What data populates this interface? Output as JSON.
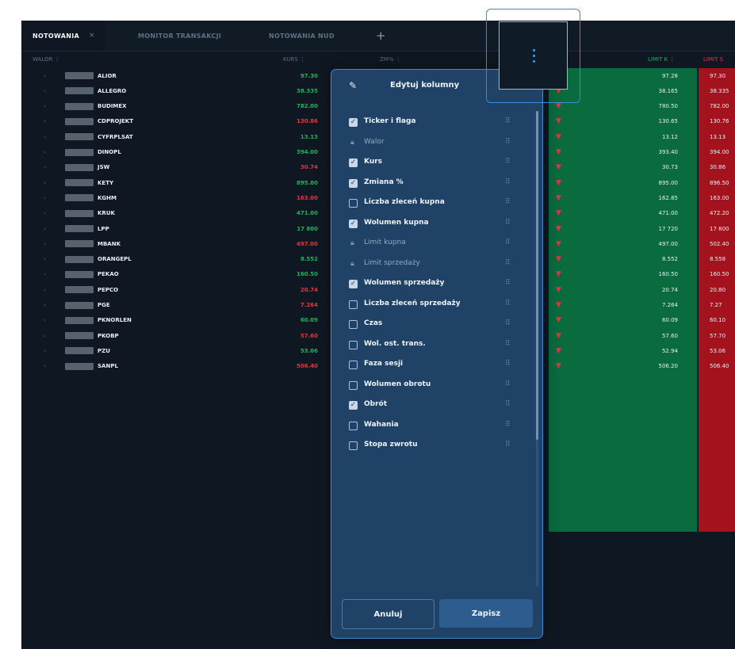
{
  "tabs": [
    {
      "label": "NOTOWANIA",
      "active": true,
      "close": "×"
    },
    {
      "label": "MONITOR TRANSAKCJI",
      "active": false
    },
    {
      "label": "NOTOWANIA NUD",
      "active": false
    }
  ],
  "add_tab": "+",
  "header": {
    "walor": "WALOR ⋮",
    "kurs": "KURS ⋮",
    "zmiana": "ZM% ⋮",
    "limit_k": "LIMIT K ⋮",
    "limit_s": "LIMIT S"
  },
  "rows": [
    {
      "ticker": "ALIOR",
      "price": "97.30",
      "color": "green",
      "limit_k": "97.28",
      "limit_s": "97.30"
    },
    {
      "ticker": "ALLEGRO",
      "price": "38.335",
      "color": "green",
      "limit_k": "38.165",
      "limit_s": "38.335"
    },
    {
      "ticker": "BUDIMEX",
      "price": "782.00",
      "color": "green",
      "limit_k": "780.50",
      "limit_s": "782.00"
    },
    {
      "ticker": "CDPROJEKT",
      "price": "130.86",
      "color": "red",
      "limit_k": "130.65",
      "limit_s": "130.76"
    },
    {
      "ticker": "CYFRPLSAT",
      "price": "13.13",
      "color": "green",
      "limit_k": "13.12",
      "limit_s": "13.13"
    },
    {
      "ticker": "DINOPL",
      "price": "394.00",
      "color": "green",
      "limit_k": "393.40",
      "limit_s": "394.00"
    },
    {
      "ticker": "JSW",
      "price": "30.74",
      "color": "red",
      "limit_k": "30.73",
      "limit_s": "30.86"
    },
    {
      "ticker": "KETY",
      "price": "895.00",
      "color": "green",
      "limit_k": "895.00",
      "limit_s": "896.50"
    },
    {
      "ticker": "KGHM",
      "price": "163.00",
      "color": "red",
      "limit_k": "162.85",
      "limit_s": "163.00"
    },
    {
      "ticker": "KRUK",
      "price": "471.00",
      "color": "green",
      "limit_k": "471.00",
      "limit_s": "472.20"
    },
    {
      "ticker": "LPP",
      "price": "17 800",
      "color": "green",
      "limit_k": "17 720",
      "limit_s": "17 800"
    },
    {
      "ticker": "MBANK",
      "price": "497.00",
      "color": "red",
      "limit_k": "497.00",
      "limit_s": "502.40"
    },
    {
      "ticker": "ORANGEPL",
      "price": "8.552",
      "color": "green",
      "limit_k": "8.552",
      "limit_s": "8.558"
    },
    {
      "ticker": "PEKAO",
      "price": "160.50",
      "color": "green",
      "limit_k": "160.50",
      "limit_s": "160.50"
    },
    {
      "ticker": "PEPCO",
      "price": "20.74",
      "color": "red",
      "limit_k": "20.74",
      "limit_s": "20.80"
    },
    {
      "ticker": "PGE",
      "price": "7.264",
      "color": "red",
      "limit_k": "7.264",
      "limit_s": "7.27"
    },
    {
      "ticker": "PKNORLEN",
      "price": "60.09",
      "color": "green",
      "limit_k": "60.09",
      "limit_s": "60.10"
    },
    {
      "ticker": "PKOBP",
      "price": "57.60",
      "color": "red",
      "limit_k": "57.60",
      "limit_s": "57.70"
    },
    {
      "ticker": "PZU",
      "price": "53.06",
      "color": "green",
      "limit_k": "52.94",
      "limit_s": "53.06"
    },
    {
      "ticker": "SANPL",
      "price": "506.40",
      "color": "red",
      "limit_k": "506.20",
      "limit_s": "506.40"
    }
  ],
  "buy_arrow": "▼",
  "modal": {
    "title": "Edytuj kolumny",
    "pencil": "✎",
    "close": "×",
    "items": [
      {
        "label": "Ticker i flaga",
        "state": "checked"
      },
      {
        "label": "Walor",
        "state": "locked"
      },
      {
        "label": "Kurs",
        "state": "checked"
      },
      {
        "label": "Zmiana %",
        "state": "checked"
      },
      {
        "label": "Liczba zleceń kupna",
        "state": "unchecked"
      },
      {
        "label": "Wolumen kupna",
        "state": "checked"
      },
      {
        "label": "Limit kupna",
        "state": "locked"
      },
      {
        "label": "Limit sprzedaży",
        "state": "locked"
      },
      {
        "label": "Wolumen sprzedaży",
        "state": "checked"
      },
      {
        "label": "Liczba zleceń sprzedaży",
        "state": "unchecked"
      },
      {
        "label": "Czas",
        "state": "unchecked"
      },
      {
        "label": "Wol. ost. trans.",
        "state": "unchecked"
      },
      {
        "label": "Faza sesji",
        "state": "unchecked"
      },
      {
        "label": "Wolumen obrotu",
        "state": "unchecked"
      },
      {
        "label": "Obrót",
        "state": "checked"
      },
      {
        "label": "Wahania",
        "state": "unchecked"
      },
      {
        "label": "Stopa zwrotu",
        "state": "unchecked"
      }
    ],
    "cancel_label": "Anuluj",
    "save_label": "Zapisz"
  },
  "colors": {
    "green": "#20b35a",
    "red": "#e3353d",
    "accent": "#3f88d4",
    "panel": "#1f4266"
  }
}
